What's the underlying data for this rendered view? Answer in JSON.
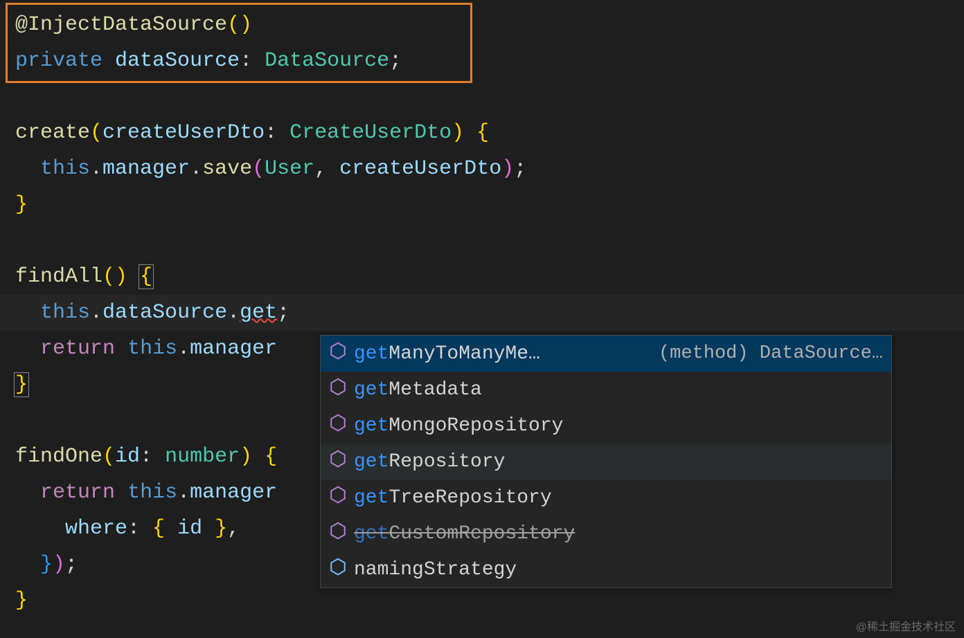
{
  "code": {
    "line1": {
      "decorator_at": "@",
      "decorator_name": "InjectDataSource",
      "parens": "()"
    },
    "line2": {
      "private_kw": "private",
      "var_name": "dataSource",
      "colon": ": ",
      "type_name": "DataSource",
      "semi": ";"
    },
    "line4": {
      "method_name": "create",
      "lparen": "(",
      "param_name": "createUserDto",
      "colon": ": ",
      "param_type": "CreateUserDto",
      "rparen": ") ",
      "lbrace": "{"
    },
    "line5": {
      "indent": "  ",
      "this_kw": "this",
      "dot1": ".",
      "prop1": "manager",
      "dot2": ".",
      "method": "save",
      "lparen": "(",
      "arg1": "User",
      "comma": ", ",
      "arg2": "createUserDto",
      "rparen": ")",
      "semi": ";"
    },
    "line6": {
      "rbrace": "}"
    },
    "line8": {
      "method_name": "findAll",
      "parens": "() ",
      "lbrace": "{"
    },
    "line9": {
      "indent": "  ",
      "this_kw": "this",
      "dot1": ".",
      "prop1": "dataSource",
      "dot2": ".",
      "prop2": "get",
      "semi": ";"
    },
    "line10": {
      "indent": "  ",
      "return_kw": "return",
      "space": " ",
      "this_kw": "this",
      "dot": ".",
      "prop": "manager"
    },
    "line11": {
      "rbrace": "}"
    },
    "line13": {
      "method_name": "findOne",
      "lparen": "(",
      "param_name": "id",
      "colon": ": ",
      "param_type": "number",
      "rparen": ") ",
      "lbrace": "{"
    },
    "line14": {
      "indent": "  ",
      "return_kw": "return",
      "space": " ",
      "this_kw": "this",
      "dot": ".",
      "prop": "manager"
    },
    "line15": {
      "indent": "    ",
      "where_key": "where",
      "colon": ": ",
      "lbrace": "{ ",
      "id_var": "id",
      "rbrace": " }",
      "comma": ","
    },
    "line16": {
      "indent": "  ",
      "rbrace": "}",
      "rparen": ")",
      "semi": ";"
    },
    "line17": {
      "rbrace": "}"
    }
  },
  "autocomplete": {
    "items": [
      {
        "match": "get",
        "rest": "ManyToManyMe…",
        "detail": "(method) DataSource…",
        "selected": true,
        "deprecated": false
      },
      {
        "match": "get",
        "rest": "Metadata",
        "detail": "",
        "selected": false,
        "deprecated": false
      },
      {
        "match": "get",
        "rest": "MongoRepository",
        "detail": "",
        "selected": false,
        "deprecated": false
      },
      {
        "match": "get",
        "rest": "Repository",
        "detail": "",
        "selected": false,
        "deprecated": false,
        "highlighted": true
      },
      {
        "match": "get",
        "rest": "TreeRepository",
        "detail": "",
        "selected": false,
        "deprecated": false
      },
      {
        "match": "get",
        "rest": "CustomRepository",
        "detail": "",
        "selected": false,
        "deprecated": true
      },
      {
        "match": "",
        "rest": "namingStrategy",
        "detail": "",
        "selected": false,
        "deprecated": false,
        "property": true
      }
    ]
  },
  "watermark": "@稀土掘金技术社区"
}
